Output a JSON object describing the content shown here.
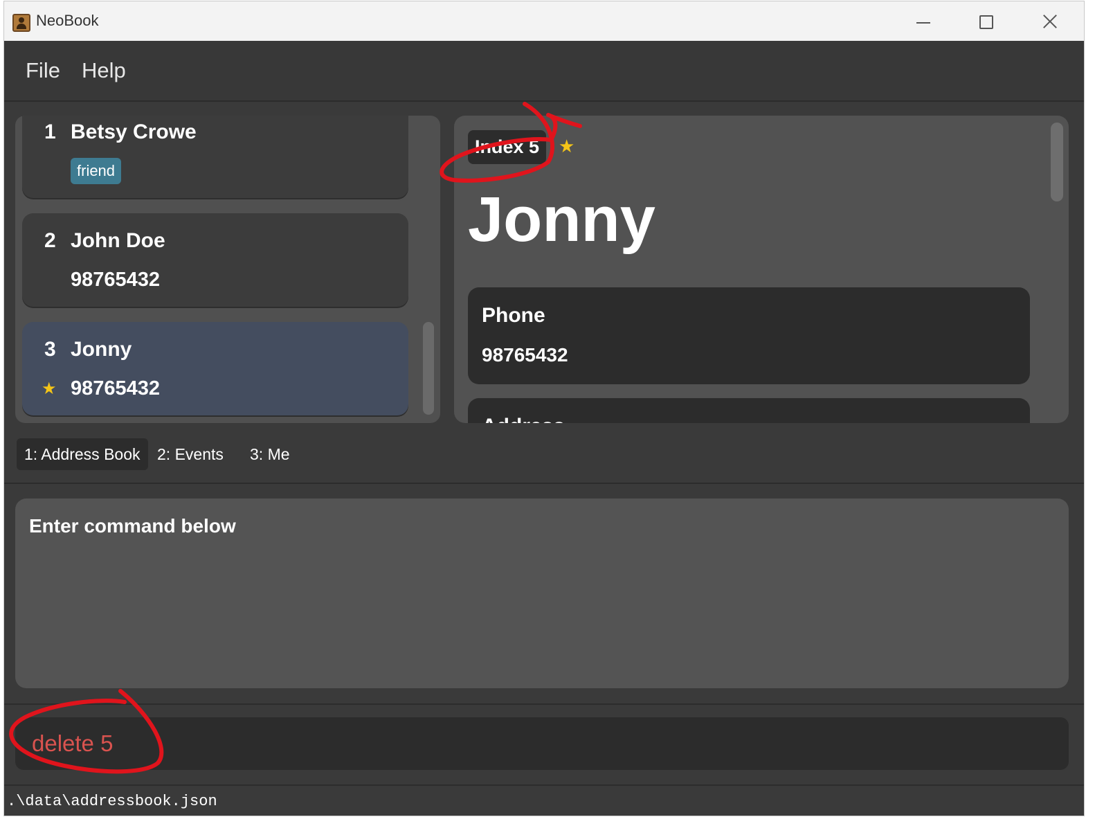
{
  "window": {
    "title": "NeoBook"
  },
  "menu": {
    "file": "File",
    "help": "Help"
  },
  "persons": [
    {
      "index": "1",
      "name": "Betsy Crowe",
      "tag": "friend"
    },
    {
      "index": "2",
      "name": "John Doe",
      "phone": "98765432"
    },
    {
      "index": "3",
      "name": "Jonny",
      "phone": "98765432",
      "favourite": true
    }
  ],
  "detail": {
    "index_badge": "Index 5",
    "favourite": true,
    "name": "Jonny",
    "phone_label": "Phone",
    "phone_value": "98765432",
    "address_label": "Address"
  },
  "tabs": [
    {
      "label": "1: Address Book",
      "active": true
    },
    {
      "label": "2: Events",
      "active": false
    },
    {
      "label": "3: Me",
      "active": false
    }
  ],
  "result": {
    "text": "Enter command below"
  },
  "command": {
    "value": "delete 5"
  },
  "status": {
    "path": ".\\data\\addressbook.json"
  },
  "colors": {
    "accent_tag": "#3e7b91",
    "selected_card": "#444d5f",
    "star": "#f5c518",
    "command_text": "#d9534f",
    "annotation": "#e0141c"
  },
  "icons": {
    "app": "contact-book-icon",
    "favourite": "star-icon"
  }
}
